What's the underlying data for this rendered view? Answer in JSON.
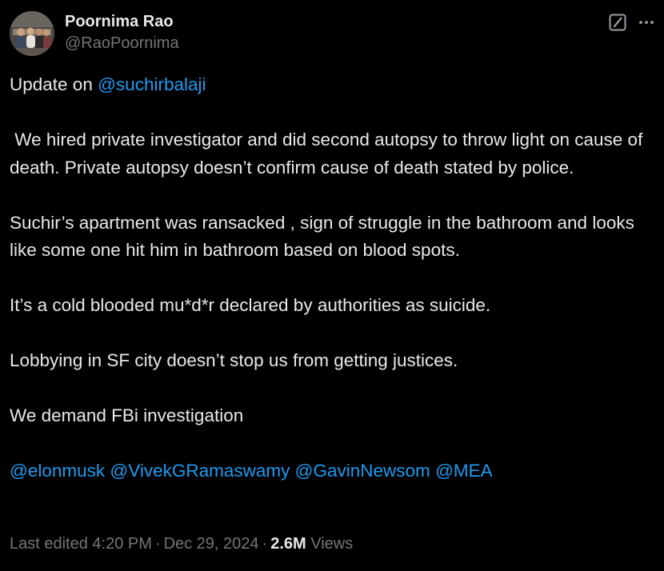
{
  "author": {
    "display_name": "Poornima Rao",
    "handle": "@RaoPoornima"
  },
  "icons": {
    "grok": "grok-icon",
    "more": "more-icon"
  },
  "tweet": {
    "line1_prefix": "Update on ",
    "line1_mention": "@suchirbalaji",
    "para2": " We hired private investigator and did second autopsy to throw light on cause of death. Private autopsy doesn’t confirm cause of death stated by police.",
    "para3": "Suchir’s apartment was ransacked , sign of struggle in the bathroom and looks like some one hit him in bathroom based on blood spots.",
    "para4": "It’s a cold blooded mu*d*r declared by authorities as suicide.",
    "para5": "Lobbying in SF city doesn’t stop us from getting justices.",
    "para6": "We demand FBi investigation",
    "mentions": [
      "@elonmusk",
      "@VivekGRamaswamy",
      "@GavinNewsom",
      "@MEA"
    ]
  },
  "meta": {
    "edited": "Last edited 4:20 PM",
    "separator": "·",
    "date": "Dec 29, 2024",
    "views_count": "2.6M",
    "views_label": "Views"
  },
  "colors": {
    "background": "#000000",
    "text": "#e7e9ea",
    "secondary": "#71767b",
    "link": "#1d9bf0"
  }
}
